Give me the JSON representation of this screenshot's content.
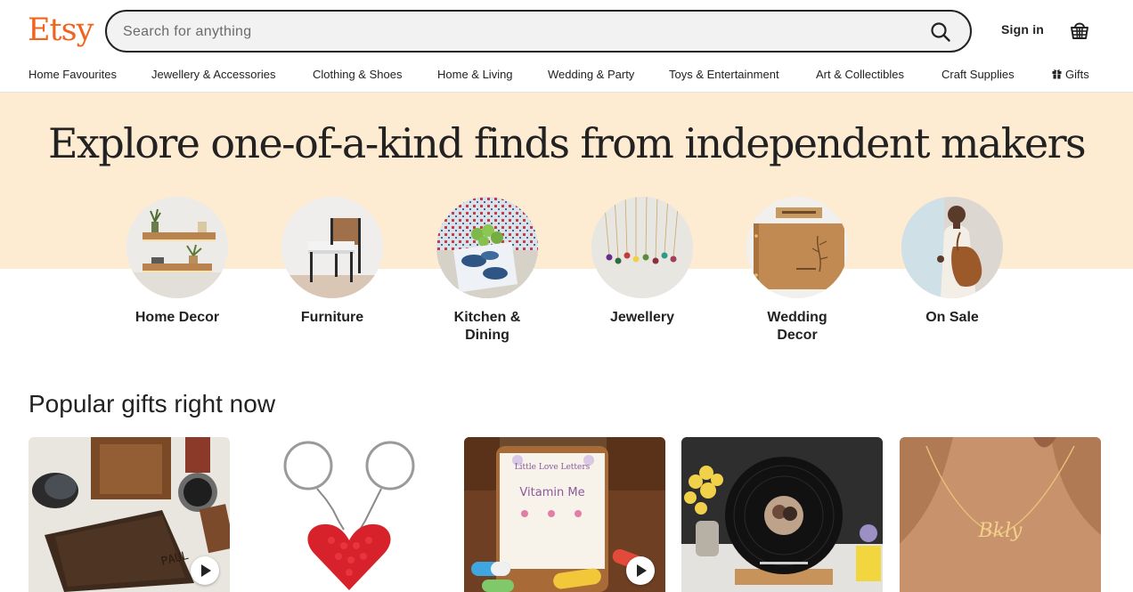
{
  "header": {
    "logo": "Etsy",
    "search_placeholder": "Search for anything",
    "sign_in": "Sign in",
    "cart_icon": "shopping-basket-icon",
    "search_icon": "search-icon"
  },
  "nav": {
    "items": [
      "Home Favourites",
      "Jewellery & Accessories",
      "Clothing & Shoes",
      "Home & Living",
      "Wedding & Party",
      "Toys & Entertainment",
      "Art & Collectibles",
      "Craft Supplies",
      "Gifts"
    ],
    "gifts_icon": "gift-icon"
  },
  "hero": {
    "title": "Explore one-of-a-kind finds from independent makers",
    "background_color": "#fdebd2",
    "categories": [
      {
        "label": "Home Decor"
      },
      {
        "label": "Furniture"
      },
      {
        "label": "Kitchen & Dining"
      },
      {
        "label": "Jewellery"
      },
      {
        "label": "Wedding Decor"
      },
      {
        "label": "On Sale"
      }
    ]
  },
  "popular": {
    "title": "Popular gifts right now",
    "cards": [
      {
        "image": "leather wallet",
        "engraved_text": "PAUL",
        "video": true
      },
      {
        "image": "heart keychain",
        "video": false
      },
      {
        "image": "vitamin jar",
        "label_top": "Little Love Letters",
        "label_main": "Vitamin Me",
        "video": true
      },
      {
        "image": "vinyl record plaque",
        "video": false
      },
      {
        "image": "name necklace",
        "necklace_text": "Bkly",
        "video": false
      }
    ]
  },
  "colors": {
    "brand": "#f1641e",
    "text": "#222222"
  }
}
